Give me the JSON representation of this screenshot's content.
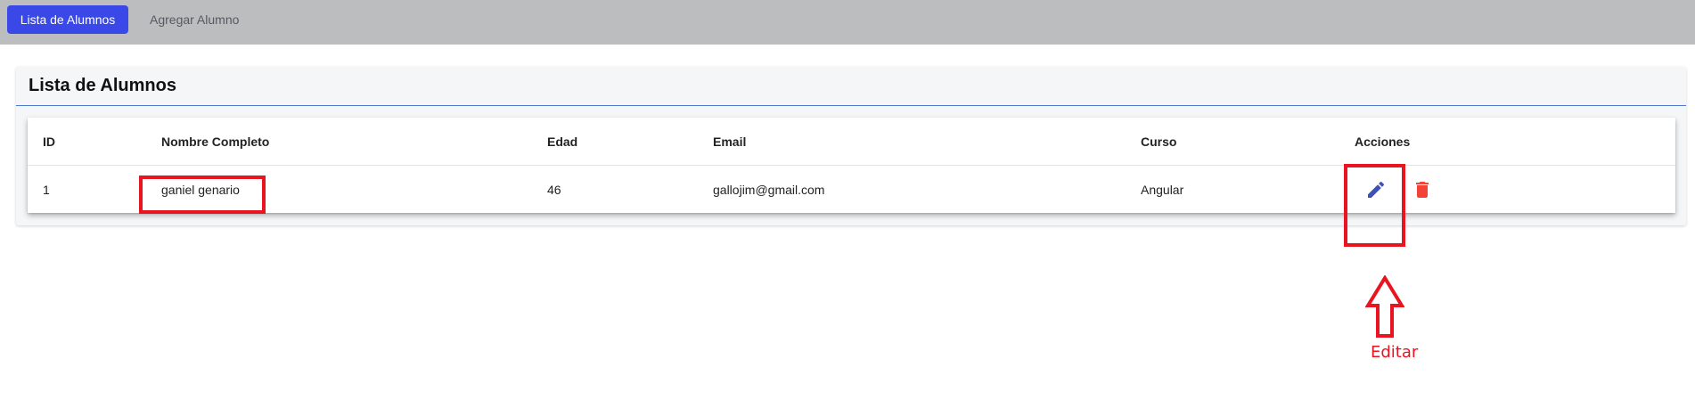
{
  "nav": {
    "items": [
      {
        "label": "Lista de Alumnos",
        "active": true
      },
      {
        "label": "Agregar Alumno",
        "active": false
      }
    ]
  },
  "card": {
    "title": "Lista de Alumnos"
  },
  "table": {
    "headers": [
      "ID",
      "Nombre Completo",
      "Edad",
      "Email",
      "Curso",
      "Acciones"
    ],
    "rows": [
      {
        "id": "1",
        "nombre": "ganiel genario",
        "edad": "46",
        "email": "gallojim@gmail.com",
        "curso": "Angular"
      }
    ],
    "actions": {
      "edit_icon": "pencil-icon",
      "delete_icon": "trash-icon"
    }
  },
  "annotation": {
    "label": "Editar"
  },
  "colors": {
    "topbar": "#bcbdbf",
    "primary": "#3a48e8",
    "edit": "#3f51b5",
    "delete": "#f44336",
    "annotation": "#e8141f",
    "divider": "#4a78d1"
  }
}
